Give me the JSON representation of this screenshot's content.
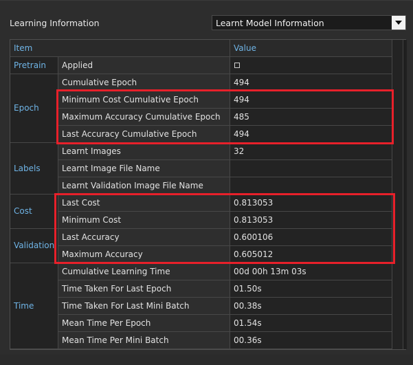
{
  "header": {
    "title": "Learning Information",
    "dropdown_value": "Learnt Model Information"
  },
  "table": {
    "col_item": "Item",
    "col_value": "Value",
    "groups": {
      "pretrain": "Pretrain",
      "epoch": "Epoch",
      "labels": "Labels",
      "cost": "Cost",
      "validation": "Validation",
      "time": "Time"
    },
    "rows": [
      {
        "key": "Applied",
        "value": "☐"
      },
      {
        "key": "Cumulative Epoch",
        "value": "494"
      },
      {
        "key": "Minimum Cost Cumulative Epoch",
        "value": "494"
      },
      {
        "key": "Maximum Accuracy Cumulative Epoch",
        "value": "485"
      },
      {
        "key": "Last Accuracy Cumulative Epoch",
        "value": "494"
      },
      {
        "key": "Learnt Images",
        "value": "32"
      },
      {
        "key": "Learnt Image File Name",
        "value": ""
      },
      {
        "key": "Learnt Validation Image File Name",
        "value": ""
      },
      {
        "key": "Last Cost",
        "value": "0.813053"
      },
      {
        "key": "Minimum Cost",
        "value": "0.813053"
      },
      {
        "key": "Last Accuracy",
        "value": "0.600106"
      },
      {
        "key": "Maximum Accuracy",
        "value": "0.605012"
      },
      {
        "key": "Cumulative Learning Time",
        "value": "00d 00h 13m 03s"
      },
      {
        "key": "Time Taken For Last Epoch",
        "value": "01.50s"
      },
      {
        "key": "Time Taken For Last Mini Batch",
        "value": "00.38s"
      },
      {
        "key": "Mean Time Per Epoch",
        "value": "01.54s"
      },
      {
        "key": "Mean Time Per Mini Batch",
        "value": "00.36s"
      }
    ]
  },
  "colors": {
    "highlight": "#e8202a",
    "group_text": "#6fb4e6"
  }
}
